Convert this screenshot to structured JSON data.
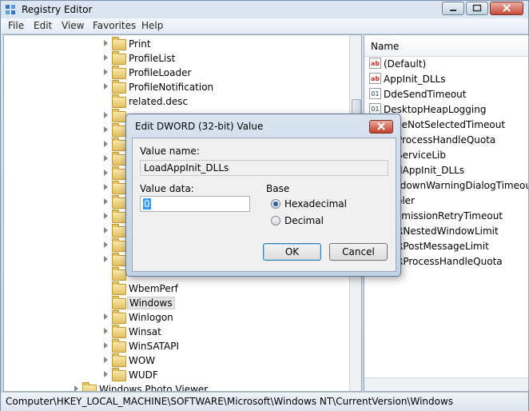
{
  "window": {
    "title": "Registry Editor",
    "accent": "#c74a38"
  },
  "menubar": {
    "items": [
      "File",
      "Edit",
      "View",
      "Favorites",
      "Help"
    ]
  },
  "tree": {
    "items": [
      {
        "label": "Print",
        "expander": true
      },
      {
        "label": "ProfileList",
        "expander": true
      },
      {
        "label": "ProfileLoader",
        "expander": true
      },
      {
        "label": "ProfileNotification",
        "expander": true
      },
      {
        "label": "related.desc",
        "expander": false
      },
      {
        "label": "WbemPerf",
        "expander": false
      },
      {
        "label": "Windows",
        "expander": false,
        "selected": true
      },
      {
        "label": "Winlogon",
        "expander": true
      },
      {
        "label": "Winsat",
        "expander": true
      },
      {
        "label": "WinSATAPI",
        "expander": true
      },
      {
        "label": "WOW",
        "expander": true
      },
      {
        "label": "WUDF",
        "expander": true
      },
      {
        "label": "Windows Photo Viewer",
        "expander": true
      }
    ]
  },
  "values": {
    "column_header": "Name",
    "items": [
      {
        "label": "(Default)",
        "icon": "string-value-icon"
      },
      {
        "label": "AppInit_DLLs",
        "icon": "string-value-icon"
      },
      {
        "label": "DdeSendTimeout",
        "icon": "dword-value-icon"
      },
      {
        "label": "DesktopHeapLogging",
        "icon": "dword-value-icon"
      },
      {
        "label": "ceNotSelectedTimeout",
        "icon": "dword-value-icon"
      },
      {
        "label": "ProcessHandleQuota",
        "icon": "dword-value-icon"
      },
      {
        "label": "ServiceLib",
        "icon": "string-value-icon"
      },
      {
        "label": "dAppInit_DLLs",
        "icon": "dword-value-icon"
      },
      {
        "label": "tdownWarningDialogTimeout",
        "icon": "dword-value-icon"
      },
      {
        "label": "oler",
        "icon": "string-value-icon"
      },
      {
        "label": "smissionRetryTimeout",
        "icon": "dword-value-icon"
      },
      {
        "label": "RNestedWindowLimit",
        "icon": "dword-value-icon"
      },
      {
        "label": "RPostMessageLimit",
        "icon": "dword-value-icon"
      },
      {
        "label": "RProcessHandleQuota",
        "icon": "dword-value-icon"
      }
    ]
  },
  "dialog": {
    "title": "Edit DWORD (32-bit) Value",
    "value_name_label": "Value name:",
    "value_name": "LoadAppInit_DLLs",
    "value_data_label": "Value data:",
    "value_data": "0",
    "base_label": "Base",
    "base_options": [
      {
        "label": "Hexadecimal",
        "selected": true
      },
      {
        "label": "Decimal",
        "selected": false
      }
    ],
    "ok_label": "OK",
    "cancel_label": "Cancel"
  },
  "statusbar": {
    "path": "Computer\\HKEY_LOCAL_MACHINE\\SOFTWARE\\Microsoft\\Windows NT\\CurrentVersion\\Windows"
  }
}
